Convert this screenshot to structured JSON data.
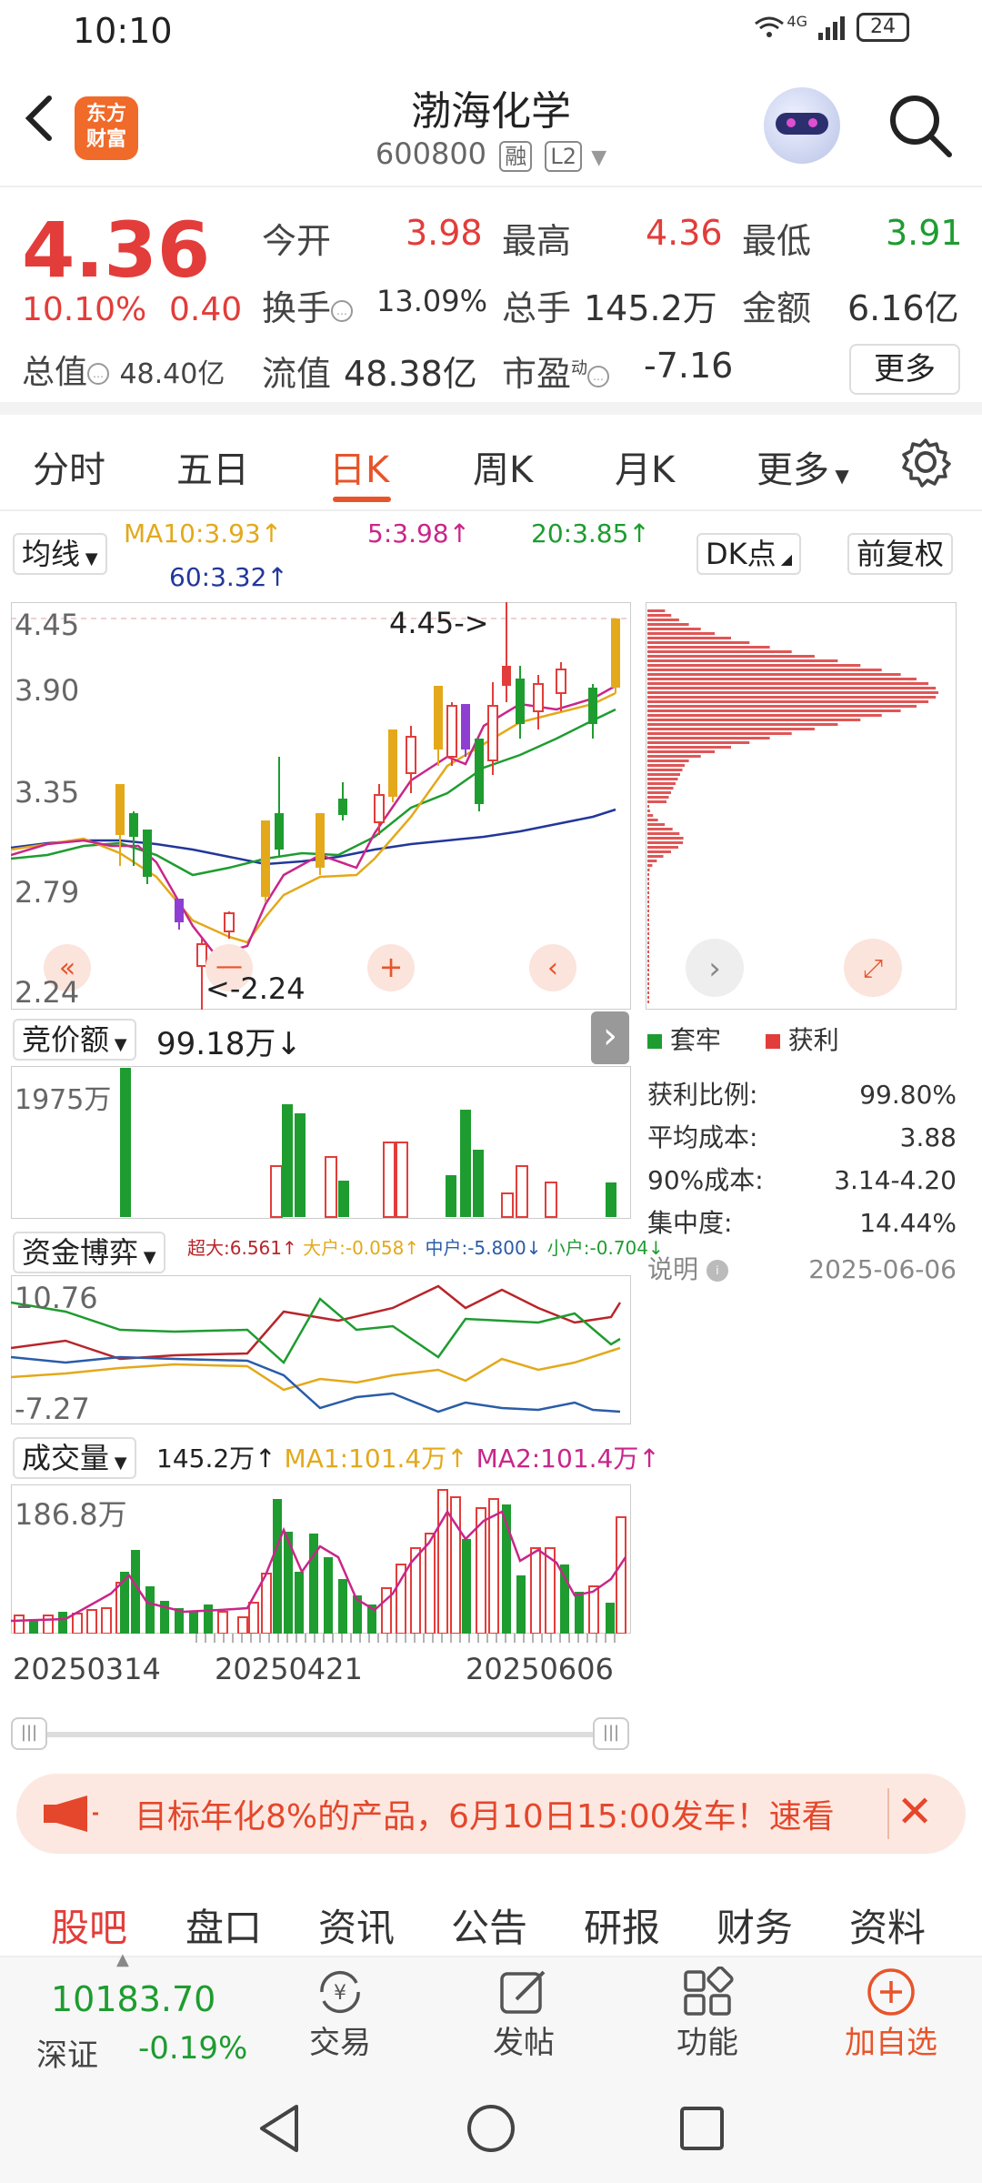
{
  "status_bar": {
    "time": "10:10",
    "network": "4G",
    "battery": "24"
  },
  "header": {
    "back_icon": "back-arrow-icon",
    "logo_line1": "东方",
    "logo_line2": "财富",
    "stock_name": "渤海化学",
    "stock_code": "600800",
    "tag_margin": "融",
    "tag_level": "L2"
  },
  "quote": {
    "price": "4.36",
    "change_pct": "10.10%",
    "change_amt": "0.40",
    "market_cap_label": "总值",
    "market_cap_value": "48.40亿",
    "open_label": "今开",
    "open_value": "3.98",
    "high_label": "最高",
    "high_value": "4.36",
    "low_label": "最低",
    "low_value": "3.91",
    "turnover_label": "换手",
    "turnover_value": "13.09%",
    "volume_label": "总手",
    "volume_value": "145.2万",
    "amount_label": "金额",
    "amount_value": "6.16亿",
    "float_cap_label": "流值",
    "float_cap_value": "48.38亿",
    "pe_label": "市盈",
    "pe_sup": "动",
    "pe_value": "-7.16",
    "more_button": "更多"
  },
  "tabs": [
    "分时",
    "五日",
    "日K",
    "周K",
    "月K",
    "更多"
  ],
  "active_tab": "日K",
  "ma_bar": {
    "selector": "均线",
    "ma10": "MA10:3.93↑",
    "ma5": "5:3.98↑",
    "ma20": "20:3.85↑",
    "ma60": "60:3.32↑",
    "dk_button": "DK点",
    "adjust_button": "前复权"
  },
  "kline": {
    "y_labels": [
      "4.45",
      "3.90",
      "3.35",
      "2.79",
      "2.24"
    ],
    "high_marker": "4.45->",
    "low_marker": "<-2.24"
  },
  "bidding": {
    "selector": "竞价额",
    "value": "99.18万↓",
    "y_label": "1975万"
  },
  "fund_flow": {
    "selector": "资金博弈",
    "super": "超大:6.561↑",
    "large": "大户:-0.058↑",
    "mid": "中户:-5.800↓",
    "small": "小户:-0.704↓",
    "y_top": "10.76",
    "y_bottom": "-7.27"
  },
  "volume": {
    "selector": "成交量",
    "value": "145.2万↑",
    "ma1": "MA1:101.4万↑",
    "ma2": "MA2:101.4万↑",
    "y_label": "186.8万"
  },
  "x_axis_dates": [
    "20250314",
    "20250421",
    "20250606"
  ],
  "chip": {
    "legend_trapped": "套牢",
    "legend_profit": "获利",
    "profit_ratio_label": "获利比例:",
    "profit_ratio_value": "99.80%",
    "avg_cost_label": "平均成本:",
    "avg_cost_value": "3.88",
    "cost90_label": "90%成本:",
    "cost90_value": "3.14-4.20",
    "concentration_label": "集中度:",
    "concentration_value": "14.44%",
    "note_label": "说明",
    "date": "2025-06-06"
  },
  "promo": {
    "text": "目标年化8%的产品，6月10日15:00发车！速看",
    "close_icon": "close-icon"
  },
  "bottom_tabs": [
    "股吧",
    "盘口",
    "资讯",
    "公告",
    "研报",
    "财务",
    "资料"
  ],
  "active_bottom_tab": "股吧",
  "toolbar": {
    "index_value": "10183.70",
    "index_name": "深证",
    "index_change": "-0.19%",
    "trade": "交易",
    "post": "发帖",
    "functions": "功能",
    "add_watch": "加自选"
  },
  "colors": {
    "up": "#e23d3a",
    "down": "#1e9c30",
    "accent": "#e8542a"
  }
}
